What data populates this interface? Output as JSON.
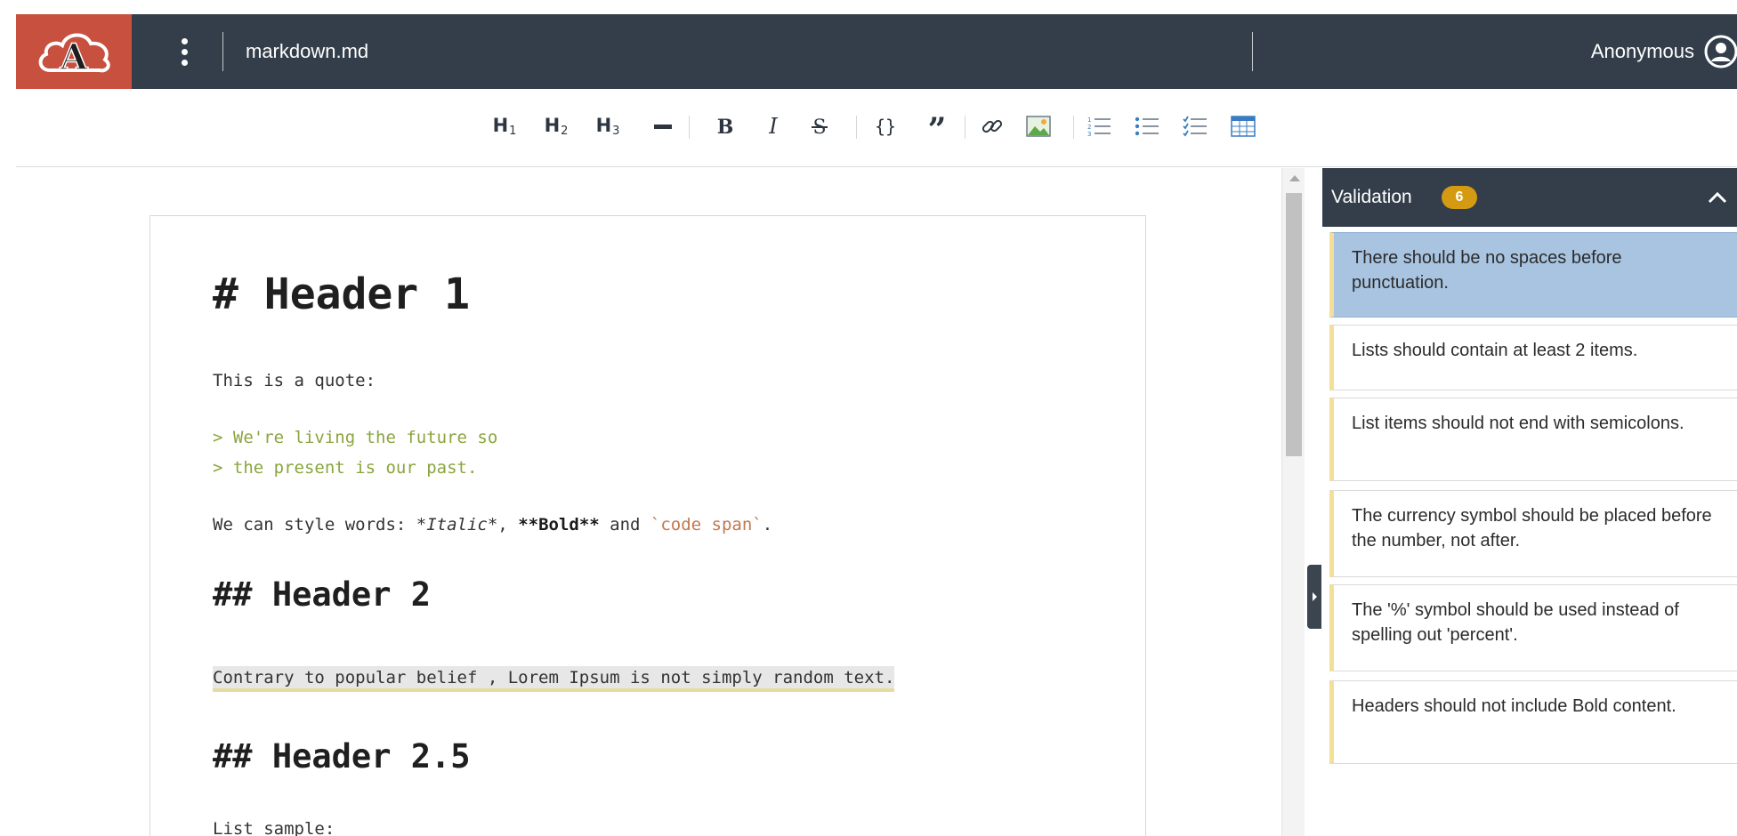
{
  "header": {
    "file_name": "markdown.md",
    "user_name": "Anonymous",
    "logo_letter": "A"
  },
  "toolbar": {
    "buttons": [
      {
        "name": "h1-button",
        "label": "H",
        "sub": "1"
      },
      {
        "name": "h2-button",
        "label": "H",
        "sub": "2"
      },
      {
        "name": "h3-button",
        "label": "H",
        "sub": "3"
      }
    ],
    "icons": [
      "heading-1-icon",
      "heading-2-icon",
      "heading-3-icon",
      "horizontal-rule-icon",
      "bold-icon",
      "italic-icon",
      "strikethrough-icon",
      "code-icon",
      "quote-icon",
      "link-icon",
      "image-icon",
      "ordered-list-icon",
      "unordered-list-icon",
      "checklist-icon",
      "table-icon"
    ]
  },
  "editor": {
    "h1": "# Header 1",
    "quote_intro": "This is a quote:",
    "quote_line_1": "> We're living the future so",
    "quote_line_2": "> the present is our past.",
    "style_prefix": "We can style words: ",
    "style_italic": "*Italic*",
    "style_comma": ", ",
    "style_bold": "**Bold**",
    "style_and": " and ",
    "style_code": "`code span`",
    "style_end": ".",
    "h2_a": "## Header 2",
    "flagged_text": "Contrary to popular belief , Lorem Ipsum is not simply random text.",
    "h2_b": "## Header 2.5",
    "list_intro": "List sample:"
  },
  "validation": {
    "title": "Validation",
    "count": "6",
    "issues": [
      {
        "text": "There should be no spaces before punctuation.",
        "active": true
      },
      {
        "text": "Lists should contain at least 2 items.",
        "active": false
      },
      {
        "text": "List items should not end with semicolons.",
        "active": false
      },
      {
        "text": "The currency symbol should be placed before the number, not after.",
        "active": false
      },
      {
        "text": "The '%' symbol should be used instead of spelling out 'percent'.",
        "active": false
      },
      {
        "text": "Headers should not include Bold content.",
        "active": false
      }
    ]
  },
  "colors": {
    "header_bg": "#333e4a",
    "logo_bg": "#c8503f",
    "badge": "#d49a12",
    "quote": "#8aa53e",
    "code": "#c4774f",
    "active_issue": "#a8c4e0",
    "issue_accent": "#f3df97"
  }
}
